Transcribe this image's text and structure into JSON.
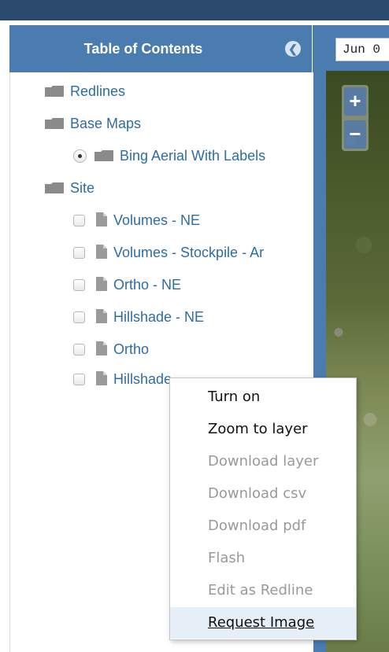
{
  "toc": {
    "title": "Table of Contents",
    "collapse_glyph": "❮",
    "items": [
      {
        "label": "Redlines",
        "type": "folder",
        "indent": 0
      },
      {
        "label": "Base Maps",
        "type": "folder",
        "indent": 0
      },
      {
        "label": "Bing Aerial With Labels",
        "type": "folder",
        "indent": 1,
        "control": "radio",
        "selected": true
      },
      {
        "label": "Site",
        "type": "folder",
        "indent": 0
      },
      {
        "label": "Volumes - NE",
        "type": "file",
        "indent": 1,
        "control": "checkbox",
        "checked": false
      },
      {
        "label": "Volumes - Stockpile - Ar",
        "type": "file",
        "indent": 1,
        "control": "checkbox",
        "checked": false
      },
      {
        "label": "Ortho - NE",
        "type": "file",
        "indent": 1,
        "control": "checkbox",
        "checked": false
      },
      {
        "label": "Hillshade - NE",
        "type": "file",
        "indent": 1,
        "control": "checkbox",
        "checked": false
      },
      {
        "label": "Ortho",
        "type": "file",
        "indent": 1,
        "control": "checkbox",
        "checked": false
      },
      {
        "label": "Hillshade",
        "type": "file",
        "indent": 1,
        "control": "checkbox",
        "checked": false
      }
    ]
  },
  "map": {
    "date_value": "Jun 0",
    "zoom_in": "+",
    "zoom_out": "−"
  },
  "context_menu": {
    "items": [
      {
        "label": "Turn on",
        "enabled": true
      },
      {
        "label": "Zoom to layer",
        "enabled": true
      },
      {
        "label": "Download layer",
        "enabled": false
      },
      {
        "label": "Download csv",
        "enabled": false
      },
      {
        "label": "Download pdf",
        "enabled": false
      },
      {
        "label": "Flash",
        "enabled": false
      },
      {
        "label": "Edit as Redline",
        "enabled": false
      },
      {
        "label": "Request Image",
        "enabled": true,
        "hovered": true
      }
    ]
  },
  "colors": {
    "topbar": "#2b4a6d",
    "panel_header": "#4a7cb0",
    "link": "#2e6da4",
    "disabled_text": "#999999",
    "hover_bg": "#e6eef7"
  }
}
